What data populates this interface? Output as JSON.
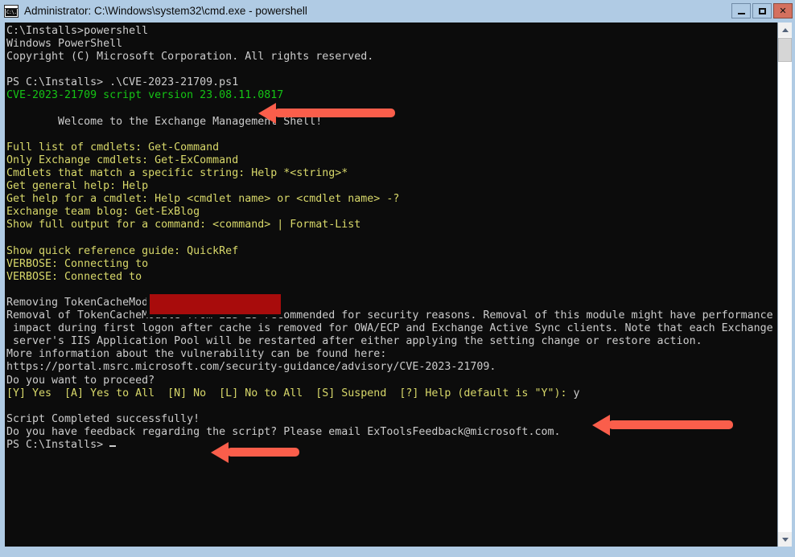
{
  "window": {
    "title": "Administrator: C:\\Windows\\system32\\cmd.exe - powershell",
    "icon_label": "C:\\.",
    "icon_name": "cmd-console-icon",
    "buttons": {
      "minimize": "–",
      "maximize": "□",
      "close": "✕"
    }
  },
  "colors": {
    "titlebar_bg": "#b0cbe4",
    "console_bg": "#0c0c0c",
    "text_white": "#cccccc",
    "text_yellow": "#d8d86a",
    "text_green": "#15c415",
    "annotation_arrow": "#fa5e4b",
    "redaction": "#a80c0c",
    "close_button": "#d4705f"
  },
  "console": {
    "lines": [
      {
        "text": "C:\\Installs>powershell",
        "color": "white"
      },
      {
        "text": "Windows PowerShell",
        "color": "white"
      },
      {
        "text": "Copyright (C) Microsoft Corporation. All rights reserved.",
        "color": "white"
      },
      {
        "text": "",
        "color": "white"
      },
      {
        "text": "PS C:\\Installs> .\\CVE-2023-21709.ps1",
        "color": "white"
      },
      {
        "text": "CVE-2023-21709 script version 23.08.11.0817",
        "color": "green"
      },
      {
        "text": "",
        "color": "white"
      },
      {
        "text": "        Welcome to the Exchange Management Shell!",
        "color": "white"
      },
      {
        "text": "",
        "color": "white"
      },
      {
        "text": "Full list of cmdlets: Get-Command",
        "color": "yellow"
      },
      {
        "text": "Only Exchange cmdlets: Get-ExCommand",
        "color": "yellow"
      },
      {
        "text": "Cmdlets that match a specific string: Help *<string>*",
        "color": "yellow"
      },
      {
        "text": "Get general help: Help",
        "color": "yellow"
      },
      {
        "text": "Get help for a cmdlet: Help <cmdlet name> or <cmdlet name> -?",
        "color": "yellow"
      },
      {
        "text": "Exchange team blog: Get-ExBlog",
        "color": "yellow"
      },
      {
        "text": "Show full output for a command: <command> | Format-List",
        "color": "yellow"
      },
      {
        "text": "",
        "color": "white"
      },
      {
        "text": "Show quick reference guide: QuickRef",
        "color": "yellow"
      },
      {
        "text": "VERBOSE: Connecting to",
        "color": "yellow"
      },
      {
        "text": "VERBOSE: Connected to",
        "color": "yellow"
      },
      {
        "text": "",
        "color": "white"
      },
      {
        "text": "Removing TokenCacheModule from IIS",
        "color": "white"
      },
      {
        "text": "Removal of TokenCacheModule from IIS is recommended for security reasons. Removal of this module might have performance",
        "color": "white"
      },
      {
        "text": " impact during first logon after cache is removed for OWA/ECP and Exchange Active Sync clients. Note that each Exchange",
        "color": "white"
      },
      {
        "text": " server's IIS Application Pool will be restarted after either applying the setting change or restore action.",
        "color": "white"
      },
      {
        "text": "More information about the vulnerability can be found here:",
        "color": "white"
      },
      {
        "text": "https://portal.msrc.microsoft.com/security-guidance/advisory/CVE-2023-21709.",
        "color": "white"
      },
      {
        "text": "Do you want to proceed?",
        "color": "white"
      }
    ],
    "prompt_line": {
      "options": "[Y] Yes  [A] Yes to All  [N] No  [L] No to All  [S] Suspend  [?] Help (default is \"Y\"): ",
      "answer": "y"
    },
    "tail_lines": [
      {
        "text": "",
        "color": "white"
      },
      {
        "text": "Script Completed successfully!",
        "color": "white"
      },
      {
        "text": "Do you have feedback regarding the script? Please email ExToolsFeedback@microsoft.com.",
        "color": "white"
      }
    ],
    "final_prompt": "PS C:\\Installs> "
  },
  "scrollbar": {
    "up_arrow": "▲",
    "down_arrow": "▼"
  },
  "annotations": [
    {
      "name": "arrow-pointing-to-script-command",
      "target": "PS C:\\Installs> .\\CVE-2023-21709.ps1"
    },
    {
      "name": "arrow-pointing-to-prompt-answer",
      "target": "y"
    },
    {
      "name": "arrow-pointing-to-success-message",
      "target": "Script Completed successfully!"
    }
  ],
  "redaction": {
    "name": "redacted-server-name",
    "label": ""
  }
}
